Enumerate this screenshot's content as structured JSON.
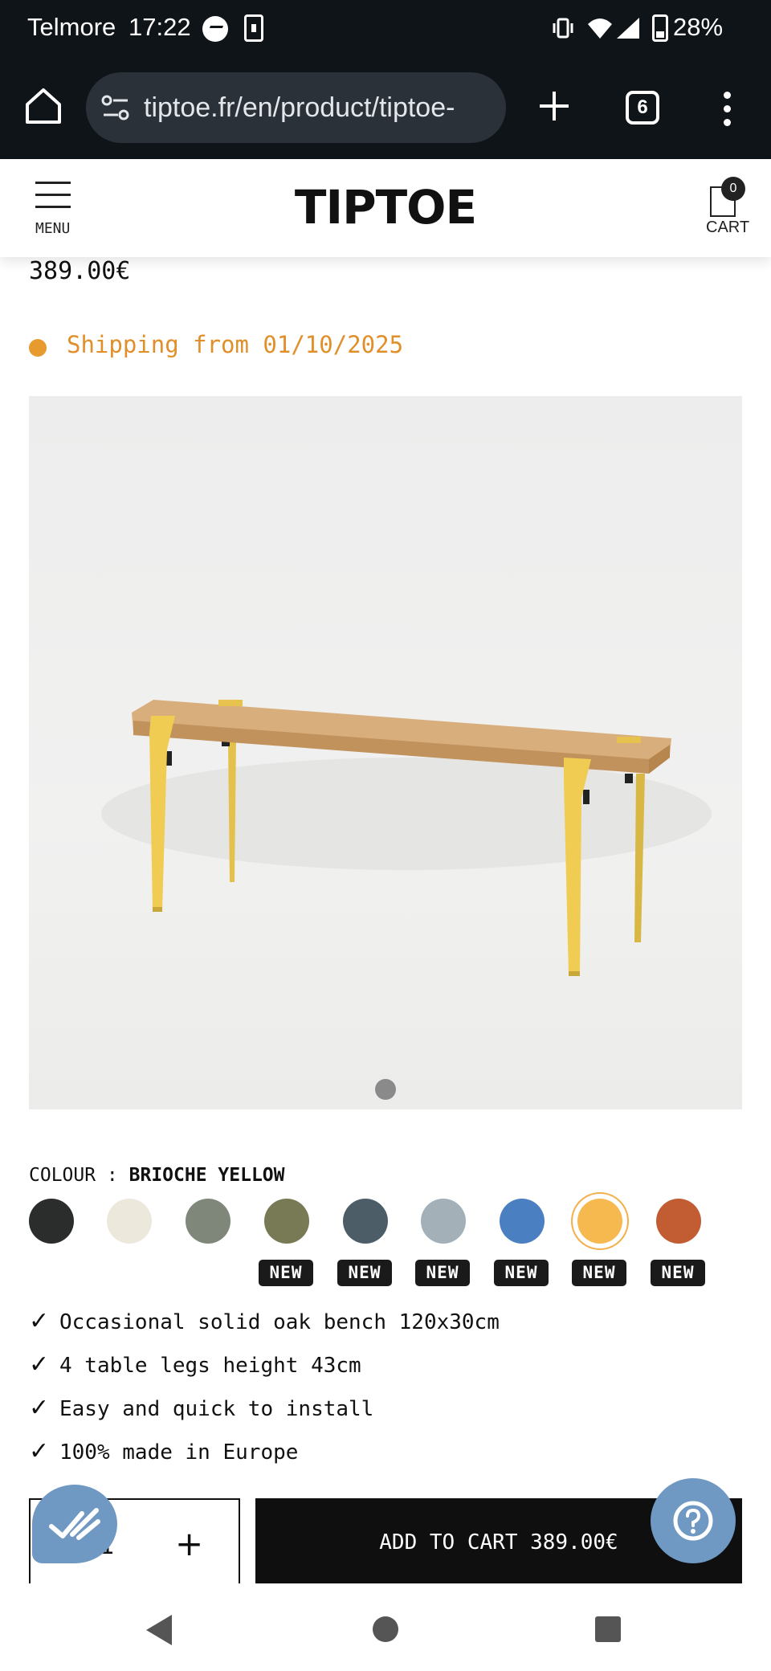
{
  "status_bar": {
    "carrier": "Telmore",
    "time": "17:22",
    "battery": "28%"
  },
  "browser": {
    "url": "tiptoe.fr/en/product/tiptoe-",
    "tab_count": "6"
  },
  "header": {
    "menu_label": "MENU",
    "logo": "TIPTOE",
    "cart_label": "CART",
    "cart_count": "0"
  },
  "product": {
    "price": "389.00€",
    "shipping": "Shipping from 01/10/2025",
    "image_alt": "Oak bench with Brioche Yellow legs",
    "carousel_dots": 1
  },
  "colour": {
    "label": "COLOUR : ",
    "selected_name": "BRIOCHE YELLOW",
    "swatches": [
      {
        "hex": "#2b2c2c",
        "new": false
      },
      {
        "hex": "#ece9dc",
        "new": false
      },
      {
        "hex": "#7f877b",
        "new": false
      },
      {
        "hex": "#777a55",
        "new": true,
        "badge": "NEW"
      },
      {
        "hex": "#4d5d68",
        "new": true,
        "badge": "NEW"
      },
      {
        "hex": "#a4b0b7",
        "new": true,
        "badge": "NEW"
      },
      {
        "hex": "#4a80c2",
        "new": true,
        "badge": "NEW"
      },
      {
        "hex": "#f5b94f",
        "new": true,
        "badge": "NEW",
        "selected": true
      },
      {
        "hex": "#c25d33",
        "new": true,
        "badge": "NEW"
      }
    ]
  },
  "features": [
    "Occasional solid oak bench 120x30cm",
    "4 table legs height 43cm",
    "Easy and quick to install",
    "100% made in Europe"
  ],
  "purchase": {
    "quantity": "1",
    "plus": "+",
    "add_to_cart_label": "ADD TO CART 389.00€"
  },
  "icons": {
    "check": "✓",
    "help": "question-mark-icon",
    "review": "double-check-icon"
  },
  "colors": {
    "chrome_bg": "#0f1419",
    "shipping_orange": "#e08f2a",
    "bubble_blue": "#6f98c2",
    "cta_black": "#0f0f0f"
  }
}
